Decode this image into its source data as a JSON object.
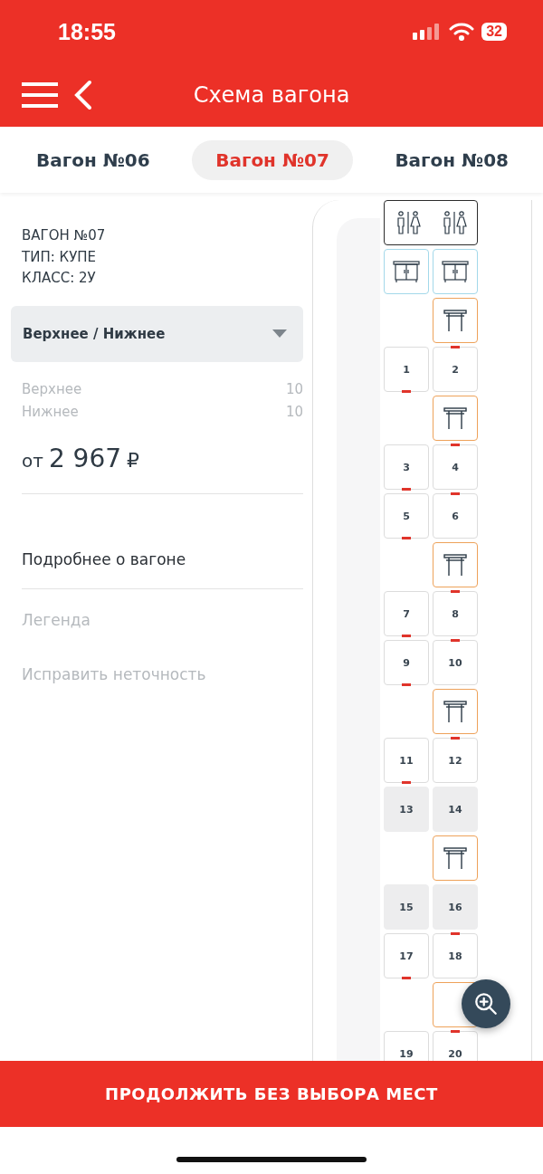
{
  "status_bar": {
    "time": "18:55",
    "battery": "32"
  },
  "header": {
    "title": "Схема вагона"
  },
  "tabs": [
    {
      "label": "Вагон №06",
      "selected": false
    },
    {
      "label": "Вагон №07",
      "selected": true
    },
    {
      "label": "Вагон №08",
      "selected": false
    }
  ],
  "car_info": [
    "ВАГОН №07",
    "ТИП: КУПЕ",
    "КЛАСС: 2У"
  ],
  "berth_filter": {
    "value": "Верхнее / Нижнее"
  },
  "berth_counts": [
    {
      "label": "Верхнее",
      "count": "10"
    },
    {
      "label": "Нижнее",
      "count": "10"
    }
  ],
  "price": {
    "prefix": "от",
    "amount": "2 967",
    "currency": "₽"
  },
  "links": [
    {
      "label": "Подробнее о вагоне",
      "disabled": false
    },
    {
      "label": "Легенда",
      "disabled": true
    },
    {
      "label": "Исправить неточность",
      "disabled": true
    }
  ],
  "seat_map": [
    {
      "kind": "toilet"
    },
    {
      "kind": "cabinet"
    },
    {
      "kind": "table"
    },
    {
      "kind": "seats",
      "seats": [
        {
          "number": "1",
          "available": true
        },
        {
          "number": "2",
          "available": true
        }
      ]
    },
    {
      "kind": "table"
    },
    {
      "kind": "seats",
      "seats": [
        {
          "number": "3",
          "available": true
        },
        {
          "number": "4",
          "available": true
        }
      ]
    },
    {
      "kind": "seats",
      "seats": [
        {
          "number": "5",
          "available": true
        },
        {
          "number": "6",
          "available": true
        }
      ]
    },
    {
      "kind": "table"
    },
    {
      "kind": "seats",
      "seats": [
        {
          "number": "7",
          "available": true
        },
        {
          "number": "8",
          "available": true
        }
      ]
    },
    {
      "kind": "seats",
      "seats": [
        {
          "number": "9",
          "available": true
        },
        {
          "number": "10",
          "available": true
        }
      ]
    },
    {
      "kind": "table"
    },
    {
      "kind": "seats",
      "seats": [
        {
          "number": "11",
          "available": true
        },
        {
          "number": "12",
          "available": true
        }
      ]
    },
    {
      "kind": "seats",
      "seats": [
        {
          "number": "13",
          "available": false
        },
        {
          "number": "14",
          "available": false
        }
      ]
    },
    {
      "kind": "table"
    },
    {
      "kind": "seats",
      "seats": [
        {
          "number": "15",
          "available": false
        },
        {
          "number": "16",
          "available": false
        }
      ]
    },
    {
      "kind": "seats",
      "seats": [
        {
          "number": "17",
          "available": true
        },
        {
          "number": "18",
          "available": true
        }
      ]
    },
    {
      "kind": "table",
      "icon_covered": true
    },
    {
      "kind": "seats",
      "seats": [
        {
          "number": "19",
          "available": true
        },
        {
          "number": "20",
          "available": true
        }
      ]
    }
  ],
  "continue_button": {
    "label": "ПРОДОЛЖИТЬ БЕЗ ВЫБОРА МЕСТ"
  }
}
